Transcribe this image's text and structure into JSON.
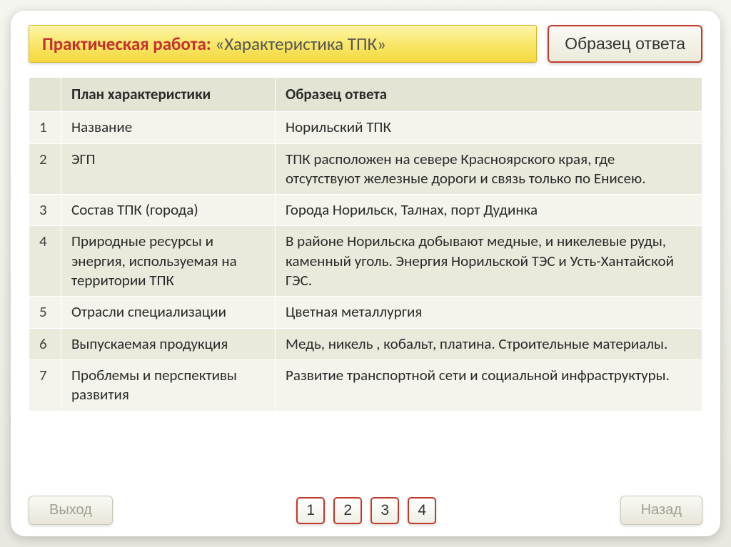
{
  "header": {
    "title_prefix": "Практическая работа:",
    "title_suffix": " «Характеристика ТПК»",
    "sample_button": "Образец ответа"
  },
  "table": {
    "headers": {
      "num": "",
      "plan": "План характеристики",
      "answer": "Образец ответа"
    },
    "rows": [
      {
        "num": "1",
        "plan": "Название",
        "answer": "Норильский ТПК"
      },
      {
        "num": "2",
        "plan": "ЭГП",
        "answer": "ТПК расположен на севере Красноярского края, где отсутствуют железные дороги и связь только по Енисею."
      },
      {
        "num": "3",
        "plan": "Состав ТПК (города)",
        "answer": "Города Норильск, Талнах, порт Дудинка"
      },
      {
        "num": "4",
        "plan": "Природные ресурсы и энергия, используемая на территории ТПК",
        "answer": "В районе Норильска  добывают медные, и никелевые руды, каменный уголь.  Энергия Норильской ТЭС и Усть-Хантайской ГЭС."
      },
      {
        "num": "5",
        "plan": "Отрасли специализации",
        "answer": "Цветная металлургия"
      },
      {
        "num": "6",
        "plan": "Выпускаемая продукция",
        "answer": "Медь, никель , кобальт, платина. Строительные материалы."
      },
      {
        "num": "7",
        "plan": "Проблемы и перспективы развития",
        "answer": "Развитие транспортной сети и социальной инфраструктуры."
      }
    ]
  },
  "footer": {
    "exit": "Выход",
    "back": "Назад",
    "pages": [
      "1",
      "2",
      "3",
      "4"
    ]
  }
}
